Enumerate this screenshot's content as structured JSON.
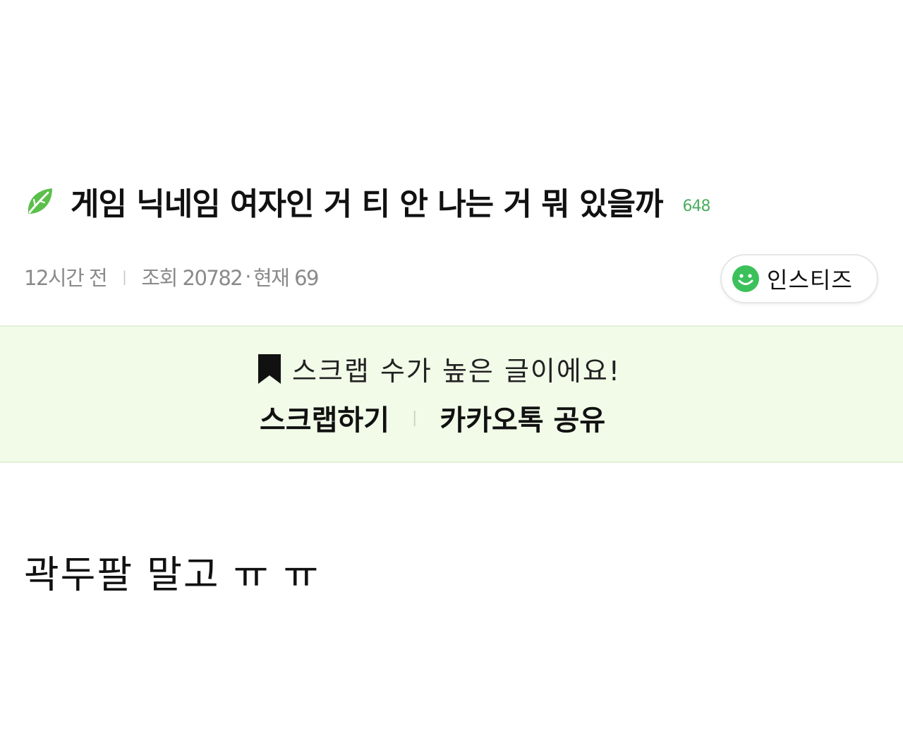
{
  "post": {
    "title": "게임 닉네임 여자인 거 티 안 나는 거 뭐 있을까",
    "comment_count": "648",
    "time_ago": "12시간 전",
    "views": "조회 20782",
    "current": "현재 69",
    "board_name": "인스티즈",
    "body": "곽두팔 말고 ㅠ ㅠ"
  },
  "scrap_banner": {
    "message": "스크랩 수가 높은 글이에요!",
    "scrap_action": "스크랩하기",
    "kakao_action": "카카오톡 공유"
  },
  "icons": {
    "leaf": "leaf-icon",
    "smile": "smile-icon",
    "bookmark": "bookmark-icon"
  },
  "colors": {
    "accent_green": "#4cae5f",
    "leaf_green": "#5bbf4a",
    "banner_bg": "#f1fbe8",
    "meta_gray": "#8a8a8a"
  }
}
